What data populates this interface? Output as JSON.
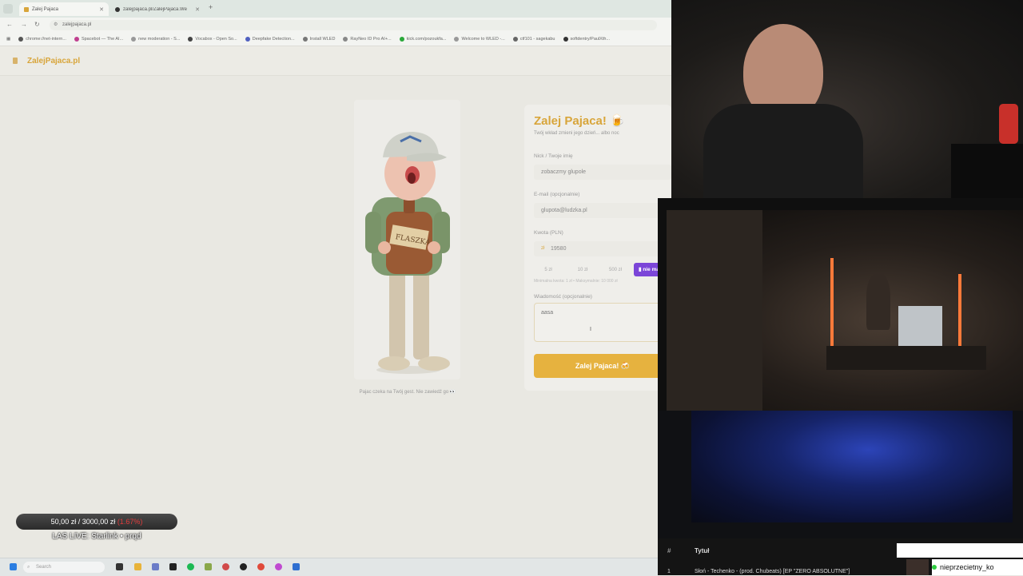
{
  "browser": {
    "tabs": [
      {
        "label": "Zalej Pajaca",
        "active": true
      },
      {
        "label": "zalejpajaca.pl/ZalejPajaca.Web",
        "active": false
      }
    ],
    "url": "zalejpajaca.pl",
    "bookmarks": [
      "chrome://net-intern...",
      "Spacebot — The AI...",
      "new moderation - S...",
      "Vocabox - Open So...",
      "Deepfake Detection...",
      "Install WLED",
      "RayNeo ID Pro AI+...",
      "kick.com/pozoukfa...",
      "Welcome to WLED -...",
      "ctf101 - sagekabu",
      "softdentry/PaulXth..."
    ]
  },
  "site": {
    "logo": "ZalejPajaca.pl",
    "caption": "Pajac czeka na Twój gest. Nie zawiedź go 👀"
  },
  "form": {
    "title": "Zalej Pajaca! 🍺",
    "subtitle": "Twój wkład zmieni jego dzień... albo noc",
    "nick_label": "Nick / Twoje imię",
    "nick_value": "zobaczmy glupole",
    "email_label": "E-mail (opcjonalnie)",
    "email_value": "glupota@ludzka.pl",
    "amount_label": "Kwota (PLN)",
    "currency": "zł",
    "amount_value": "19580",
    "presets": [
      "5 zł",
      "10 zł",
      "500 zł"
    ],
    "nie_button": "nie ma",
    "limits": "Minimalna kwota: 1 zł • Maksymalnie: 10 000 zł",
    "message_label": "Wiadomość (opcjonalnie)",
    "message_value": "aasa",
    "submit": "Zalej Pajaca! 🍻"
  },
  "overlay": {
    "goal_current": "50,00 zł",
    "goal_sep": "/",
    "goal_target": "3000,00 zł",
    "goal_pct": "(1.67%)",
    "live_title": "LAS LIVE: Starlink • prqd"
  },
  "taskbar": {
    "search_placeholder": "Search"
  },
  "playlist": {
    "col_hash": "#",
    "col_title": "Tytuł",
    "row_num": "1",
    "row_track": "Słoń - Techenko - (prod. Chubeats) [EP \"ZERO ABSOLUTNE\"]"
  },
  "chat": {
    "username": "nieprzecietny_ko"
  },
  "colors": {
    "brand": "#d8a53a",
    "submit": "#e6b23f",
    "nie_button": "#7b45d8",
    "goal_pct": "#e13b3b"
  }
}
